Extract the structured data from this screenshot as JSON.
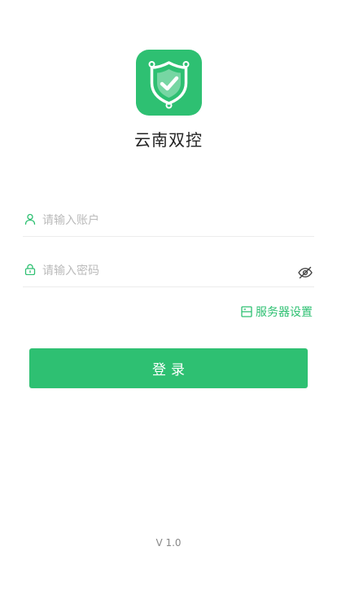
{
  "app": {
    "title": "云南双控",
    "version": "V 1.0"
  },
  "colors": {
    "brand": "#2ec072",
    "placeholder": "#bbbbbb",
    "divider": "#ececec"
  },
  "form": {
    "account": {
      "value": "",
      "placeholder": "请输入账户",
      "icon": "user-icon"
    },
    "password": {
      "value": "",
      "placeholder": "请输入密码",
      "icon": "lock-icon",
      "toggle_icon": "eye-off-icon"
    },
    "server_settings": {
      "label": "服务器设置",
      "icon": "server-icon"
    },
    "login_button": {
      "label": "登录"
    }
  },
  "logo": {
    "icon": "shield-check-icon"
  }
}
